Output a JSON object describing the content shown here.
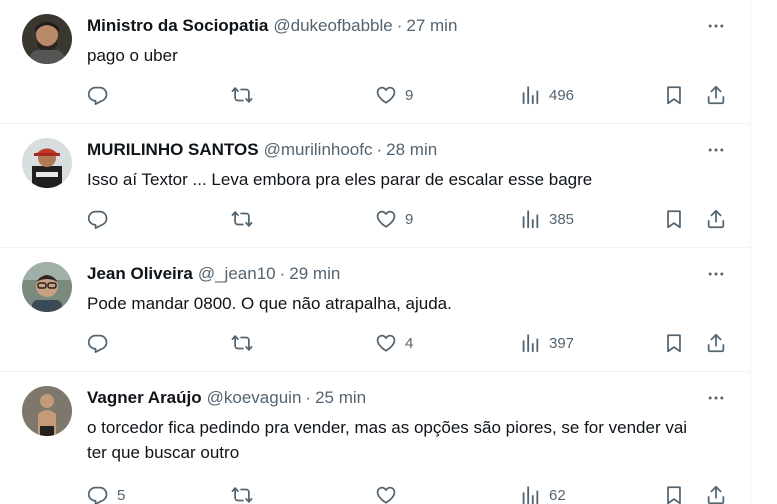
{
  "tweets": [
    {
      "name": "Ministro da Sociopatia",
      "handle": "@dukeofbabble",
      "separator": "·",
      "time": "27 min",
      "text": "pago o uber",
      "replies": "",
      "retweets": "",
      "likes": "9",
      "views": "496"
    },
    {
      "name": "MURILINHO SANTOS",
      "handle": "@murilinhoofc",
      "separator": "·",
      "time": "28 min",
      "text": "Isso aí Textor ... Leva embora pra eles parar de escalar esse bagre",
      "replies": "",
      "retweets": "",
      "likes": "9",
      "views": "385"
    },
    {
      "name": "Jean Oliveira",
      "handle": "@_jean10",
      "separator": "·",
      "time": "29 min",
      "text": "Pode mandar 0800. O que não atrapalha, ajuda.",
      "replies": "",
      "retweets": "",
      "likes": "4",
      "views": "397"
    },
    {
      "name": "Vagner Araújo",
      "handle": "@koevaguin",
      "separator": "·",
      "time": "25 min",
      "text": "o torcedor fica pedindo pra vender, mas as opções são piores, se for vender vai ter que buscar outro",
      "replies": "5",
      "retweets": "",
      "likes": "",
      "views": "62"
    }
  ],
  "icons": {
    "more": "more-icon",
    "reply": "reply-icon",
    "retweet": "retweet-icon",
    "like": "heart-icon",
    "views": "views-icon",
    "bookmark": "bookmark-icon",
    "share": "share-icon"
  },
  "colors": {
    "text": "#0f1419",
    "secondary": "#536471",
    "divider": "#eff3f4"
  }
}
